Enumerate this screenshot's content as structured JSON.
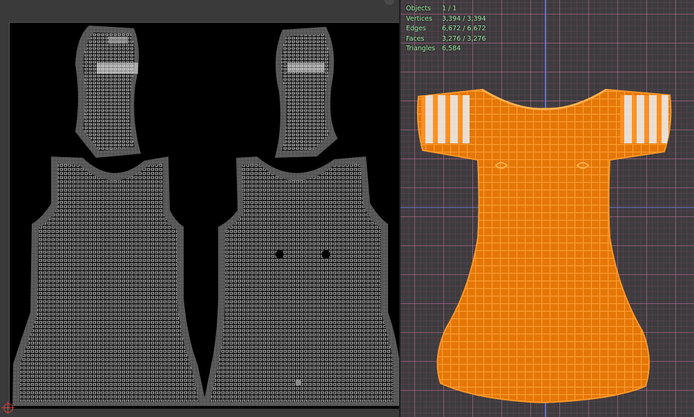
{
  "uv_editor": {
    "islands": [
      "sleeve-left",
      "sleeve-right",
      "dress-front",
      "dress-back"
    ]
  },
  "viewport": {
    "stats": [
      {
        "label": "Objects",
        "value": "1 / 1"
      },
      {
        "label": "Vertices",
        "value": "3,394 / 3,394"
      },
      {
        "label": "Edges",
        "value": "6,672 / 6,672"
      },
      {
        "label": "Faces",
        "value": "3,276 / 3,276"
      },
      {
        "label": "Triangles",
        "value": "6,584"
      }
    ]
  },
  "colors": {
    "uv_canvas": "#000000",
    "uv_wire": "#ffffff",
    "uv_island_border": "#5a5a5a",
    "viewport_bg": "#3e3b3e",
    "grid": "#be6e96",
    "axis": "#6a72c8",
    "mesh_fill": "#e7770a",
    "mesh_wire": "#ff9224",
    "stats_text": "#9bf0a4"
  }
}
